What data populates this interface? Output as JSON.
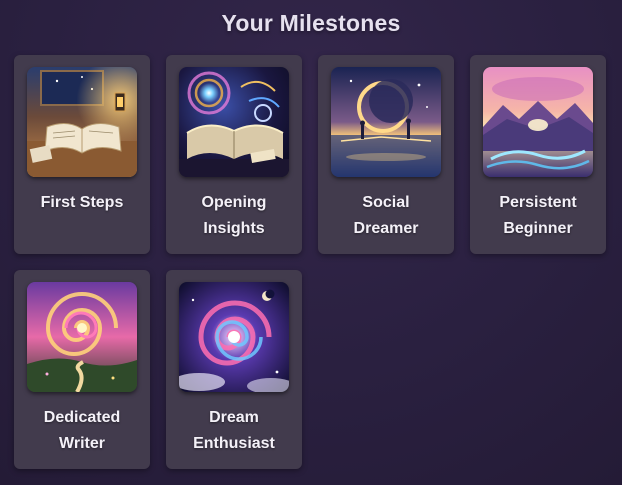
{
  "page": {
    "title": "Your Milestones"
  },
  "milestones": [
    {
      "line1": "First Steps",
      "line2": "",
      "icon": "open-book-icon"
    },
    {
      "line1": "Opening",
      "line2": "Insights",
      "icon": "cosmic-book-icon"
    },
    {
      "line1": "Social",
      "line2": "Dreamer",
      "icon": "moon-reflection-icon"
    },
    {
      "line1": "Persistent",
      "line2": "Beginner",
      "icon": "sunrise-mountains-icon"
    },
    {
      "line1": "Dedicated",
      "line2": "Writer",
      "icon": "swirl-path-icon"
    },
    {
      "line1": "Dream",
      "line2": "Enthusiast",
      "icon": "galaxy-spiral-icon"
    }
  ],
  "colors": {
    "background": "#2a2040",
    "card": "#423b4d",
    "title": "#e6e1ef",
    "label": "#f4f1f8"
  }
}
